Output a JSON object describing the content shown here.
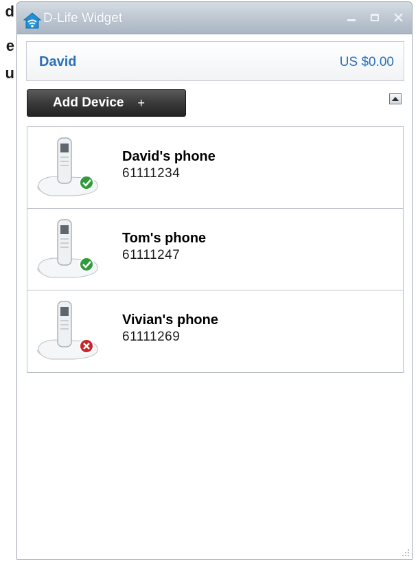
{
  "background_text": {
    "line1": "d",
    "line2": "e",
    "line3": "u"
  },
  "window": {
    "title": "D-Life Widget",
    "controls": {
      "minimize": "minimize-icon",
      "maximize": "maximize-icon",
      "close": "close-icon"
    }
  },
  "account": {
    "name": "David",
    "balance": "US $0.00"
  },
  "toolbar": {
    "add_device_label": "Add Device",
    "add_device_plus": "+",
    "collapse_icon": "triangle-up-icon"
  },
  "devices": [
    {
      "name": "David's phone",
      "number": "61111234",
      "status": "online",
      "status_color": "#2f9b3b"
    },
    {
      "name": "Tom's phone",
      "number": "61111247",
      "status": "online",
      "status_color": "#2f9b3b"
    },
    {
      "name": "Vivian's phone",
      "number": "61111269",
      "status": "offline",
      "status_color": "#c9262c"
    }
  ],
  "colors": {
    "accent": "#2a6fba",
    "titlebar": "#bcc6d1",
    "button_dark": "#3a3a3a"
  }
}
